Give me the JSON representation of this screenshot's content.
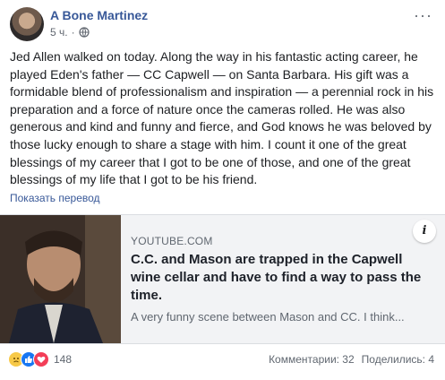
{
  "post": {
    "author": "A Bone Martinez",
    "time": "5 ч.",
    "text": "Jed Allen walked on today. Along the way in his fantastic acting career, he played Eden's father — CC Capwell — on Santa Barbara. His gift was a formidable blend of professionalism and inspiration — a perennial rock in his preparation and a force of nature once the cameras rolled. He was also generous and kind and funny and fierce, and God knows he was beloved by those lucky enough to share a stage with him. I count it one of the great blessings of my career that I got to be one of those, and one of the great blessings of my life that I got to be his friend.",
    "translate_label": "Показать перевод"
  },
  "link_card": {
    "domain": "YOUTUBE.COM",
    "title": "C.C. and Mason are trapped in the Capwell wine cellar and have to find a way to pass the time.",
    "description": "A very funny scene between Mason and CC. I think...",
    "info_label": "i"
  },
  "footer": {
    "reaction_icons": [
      "sad-reaction-icon",
      "like-reaction-icon",
      "love-reaction-icon"
    ],
    "reaction_count": "148",
    "comments": "Комментарии: 32",
    "shares": "Поделились: 4"
  },
  "colors": {
    "author_link": "#385898",
    "card_bg": "#f2f3f5",
    "like_blue": "#1877f2",
    "love_red": "#f33e58"
  }
}
